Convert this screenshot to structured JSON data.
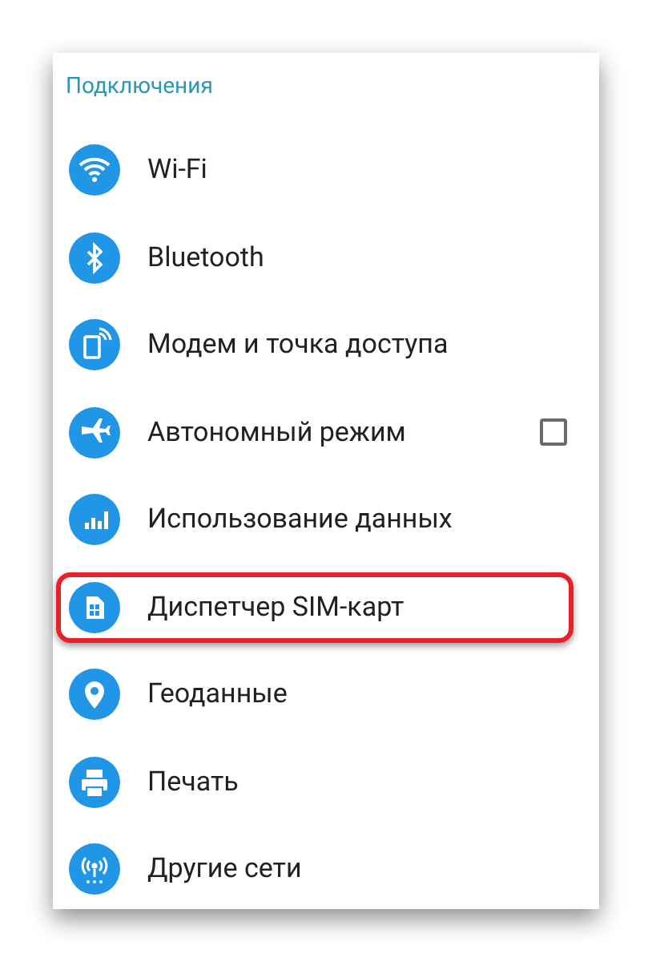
{
  "section": {
    "title": "Подключения"
  },
  "items": [
    {
      "label": "Wi-Fi",
      "kind": "link",
      "highlighted": false
    },
    {
      "label": "Bluetooth",
      "kind": "link",
      "highlighted": false
    },
    {
      "label": "Модем и точка доступа",
      "kind": "link",
      "highlighted": false
    },
    {
      "label": "Автономный режим",
      "kind": "checkbox",
      "checked": false,
      "highlighted": false
    },
    {
      "label": "Использование данных",
      "kind": "link",
      "highlighted": false
    },
    {
      "label": "Диспетчер SIM-карт",
      "kind": "link",
      "highlighted": true
    },
    {
      "label": "Геоданные",
      "kind": "link",
      "highlighted": false
    },
    {
      "label": "Печать",
      "kind": "link",
      "highlighted": false
    },
    {
      "label": "Другие сети",
      "kind": "link",
      "highlighted": false
    }
  ]
}
